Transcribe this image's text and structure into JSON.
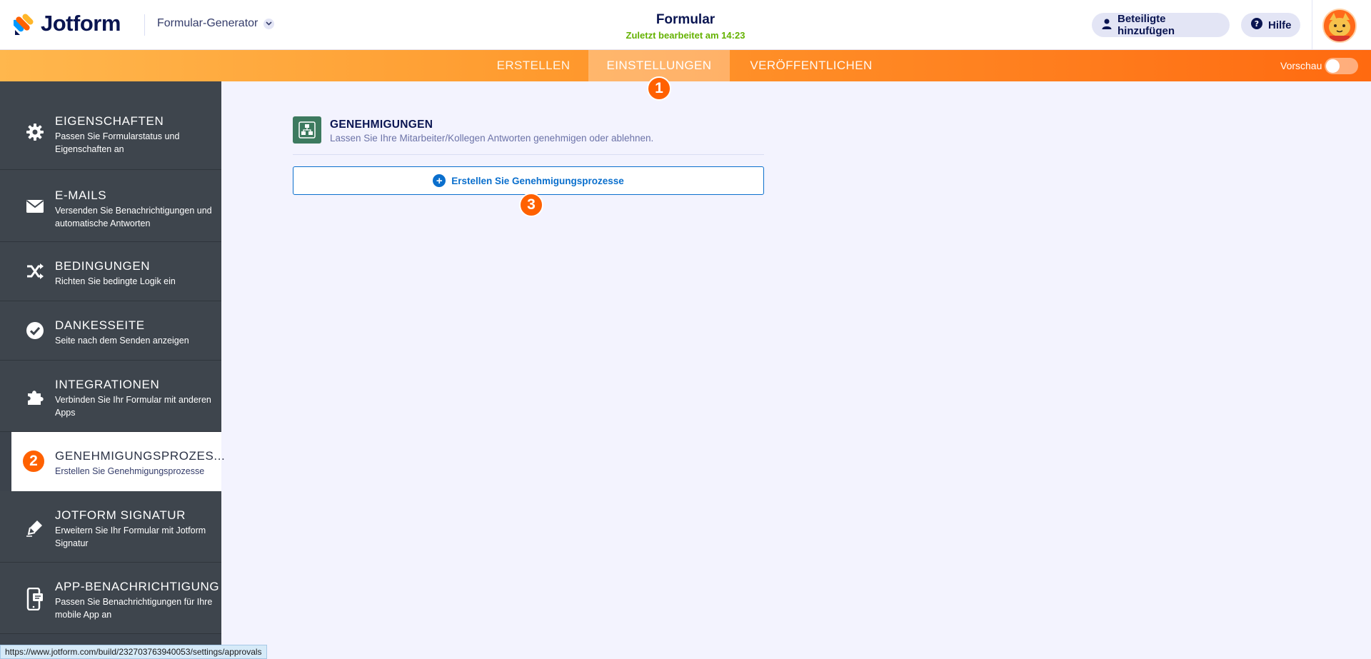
{
  "header": {
    "brand": "Jotform",
    "builder_label": "Formular-Generator",
    "form_title": "Formular",
    "last_edited": "Zuletzt bearbeitet am 14:23",
    "add_participants": "Beteiligte hinzufügen",
    "help": "Hilfe"
  },
  "nav": {
    "tabs": [
      "ERSTELLEN",
      "EINSTELLUNGEN",
      "VERÖFFENTLICHEN"
    ],
    "active_tab": "EINSTELLUNGEN",
    "preview_label": "Vorschau",
    "preview_on": false
  },
  "step_badges": [
    "1",
    "2",
    "3"
  ],
  "sidebar": {
    "items": [
      {
        "title": "EIGENSCHAFTEN",
        "desc": "Passen Sie Formularstatus und Eigenschaften an",
        "icon": "gear-icon"
      },
      {
        "title": "E-MAILS",
        "desc": "Versenden Sie Benachrichtigungen und automatische Antworten",
        "icon": "envelope-icon"
      },
      {
        "title": "BEDINGUNGEN",
        "desc": "Richten Sie bedingte Logik ein",
        "icon": "shuffle-icon"
      },
      {
        "title": "DANKESSEITE",
        "desc": "Seite nach dem Senden anzeigen",
        "icon": "check-circle-icon"
      },
      {
        "title": "INTEGRATIONEN",
        "desc": "Verbinden Sie Ihr Formular mit anderen Apps",
        "icon": "puzzle-icon"
      },
      {
        "title": "GENEHMIGUNGSPROZES...",
        "desc": "Erstellen Sie Genehmigungsprozesse",
        "icon": "approval-icon"
      },
      {
        "title": "JOTFORM SIGNATUR",
        "desc": "Erweitern Sie Ihr Formular mit Jotform Signatur",
        "icon": "pen-icon"
      },
      {
        "title": "APP-BENACHRICHTIGUNG",
        "desc": "Passen Sie Benachrichtigungen für Ihre mobile App an",
        "icon": "mobile-icon"
      }
    ],
    "active_index": 5
  },
  "panel": {
    "title": "GENEHMIGUNGEN",
    "description": "Lassen Sie Ihre Mitarbeiter/Kollegen Antworten genehmigen oder ablehnen.",
    "create_button": "Erstellen Sie Genehmigungsprozesse"
  },
  "status_url": "https://www.jotform.com/build/232703763940053/settings/approvals",
  "colors": {
    "accent_orange": "#ff6100",
    "sidebar_bg": "#3e454d",
    "link_blue": "#0a6fcd",
    "approval_green": "#3d7a5f",
    "edited_green": "#64b200"
  }
}
